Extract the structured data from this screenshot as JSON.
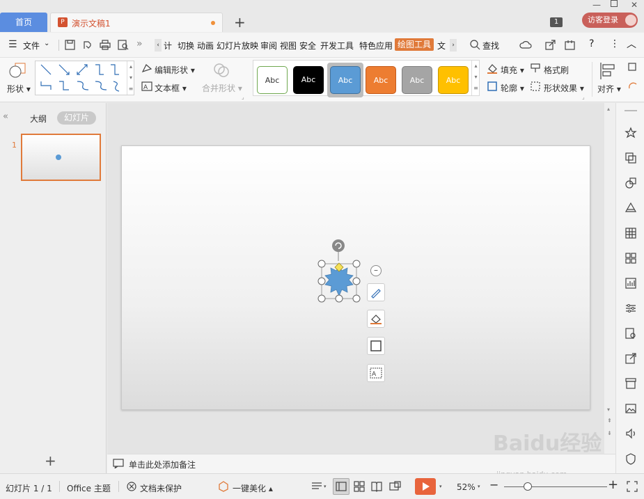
{
  "titlebar": {
    "home_tab": "首页",
    "doc_tab": "演示文稿1",
    "doc_icon_letter": "P",
    "window_count": "1",
    "login": "访客登录"
  },
  "menu": {
    "file": "文件",
    "items": [
      "计",
      "切换",
      "动画",
      "幻灯片放映",
      "审阅",
      "视图",
      "安全",
      "开发工具",
      "特色应用",
      "绘图工具",
      "文"
    ],
    "active": "绘图工具",
    "search": "查找"
  },
  "ribbon": {
    "shape": "形状",
    "edit_shape": "编辑形状",
    "textbox": "文本框",
    "merge_shape": "合并形状",
    "styles": [
      {
        "label": "Abc",
        "bg": "#ffffff",
        "fg": "#333333",
        "border": "#6fa84f"
      },
      {
        "label": "Abc",
        "bg": "#000000",
        "fg": "#ffffff",
        "border": "#000000"
      },
      {
        "label": "Abc",
        "bg": "#5b9bd5",
        "fg": "#ffffff",
        "border": "#41719c"
      },
      {
        "label": "Abc",
        "bg": "#ed7d31",
        "fg": "#ffffff",
        "border": "#c45a1b"
      },
      {
        "label": "Abc",
        "bg": "#a5a5a5",
        "fg": "#ffffff",
        "border": "#7f7f7f"
      },
      {
        "label": "Abc",
        "bg": "#ffc000",
        "fg": "#ffffff",
        "border": "#c79500"
      }
    ],
    "fill": "填充",
    "outline": "轮廓",
    "format_painter": "格式刷",
    "shape_effect": "形状效果",
    "align": "对齐"
  },
  "left_panel": {
    "outline_tab": "大纲",
    "slides_tab": "幻灯片",
    "slide_number": "1"
  },
  "notes": {
    "placeholder": "单击此处添加备注"
  },
  "status": {
    "slide": "幻灯片 1 / 1",
    "theme": "Office 主题",
    "protect": "文档未保护",
    "beautify": "一键美化",
    "zoom": "52%"
  },
  "watermark": {
    "text": "Baidu经验",
    "url": "jingyan.baidu.com"
  },
  "colors": {
    "accent": "#e07a3a",
    "shape_fill": "#5b9bd5",
    "home_tab": "#5b8de0"
  }
}
